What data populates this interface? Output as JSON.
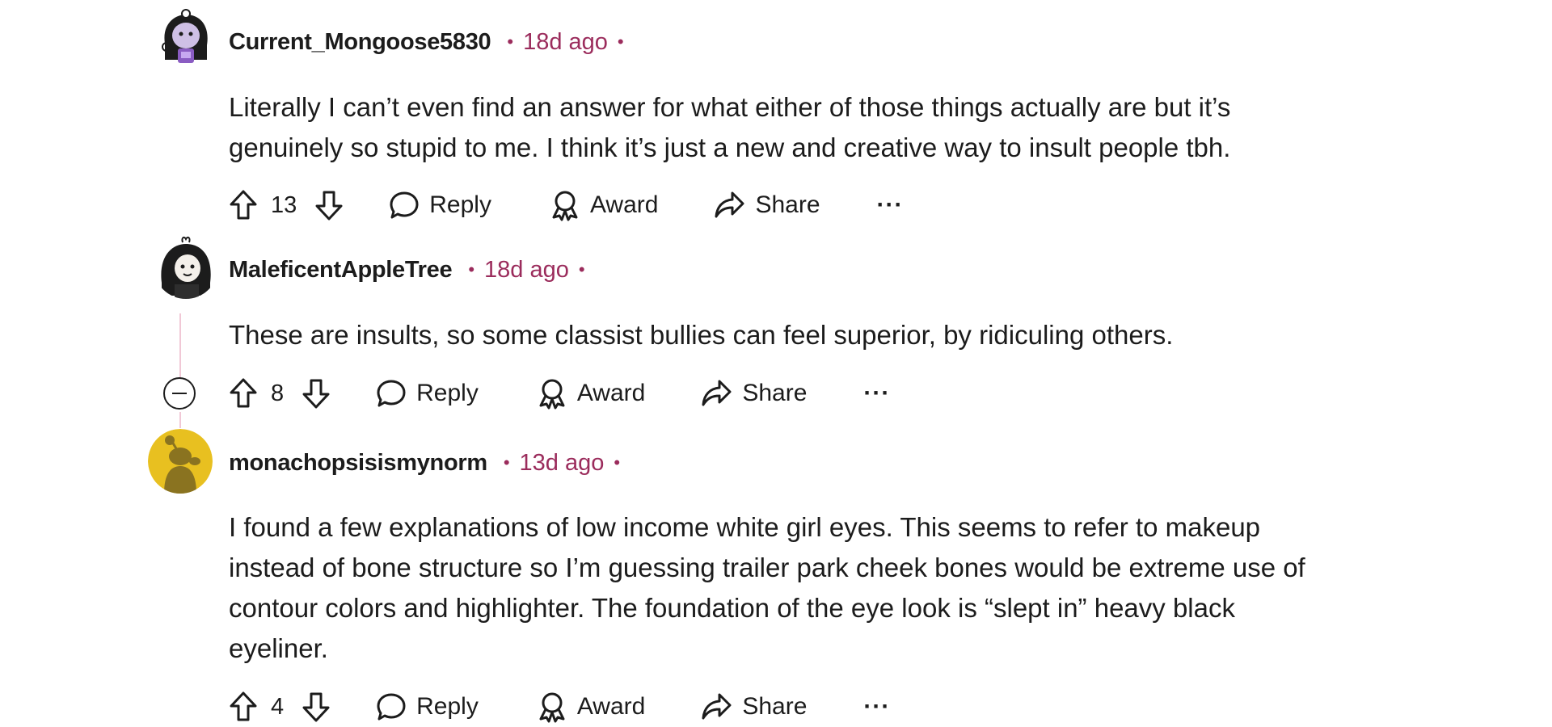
{
  "comments": [
    {
      "username": "Current_Mongoose5830",
      "time": "18d ago",
      "body": [
        "Literally I can’t even find an answer for what either of those things actually are but it’s",
        "genuinely so stupid to me. I think it’s just a new and creative way to insult people tbh."
      ],
      "votes": "13",
      "reply": "Reply",
      "award": "Award",
      "share": "Share",
      "more": "···",
      "avatar": "robot-girl-avatar-icon"
    },
    {
      "username": "MaleficentAppleTree",
      "time": "18d ago",
      "body": [
        "These are insults, so some classist bullies can feel superior, by ridiculing others."
      ],
      "votes": "8",
      "reply": "Reply",
      "award": "Award",
      "share": "Share",
      "more": "···",
      "avatar": "dark-hair-avatar-icon"
    },
    {
      "username": "monachopsisismynorm",
      "time": "13d ago",
      "body": [
        "I found a few explanations of low income white girl eyes. This seems to refer to makeup",
        "instead of bone structure so I’m guessing trailer park cheek bones would be extreme use of",
        "contour colors and highlighter. The foundation of the eye look is “slept in” heavy black",
        "eyeliner."
      ],
      "votes": "4",
      "reply": "Reply",
      "award": "Award",
      "share": "Share",
      "more": "···",
      "avatar": "default-snoo-avatar-icon"
    }
  ],
  "colors": {
    "meta": "#9b2c5c",
    "thread_line": "#f1c8d6",
    "default_avatar_bg": "#e8c020"
  }
}
